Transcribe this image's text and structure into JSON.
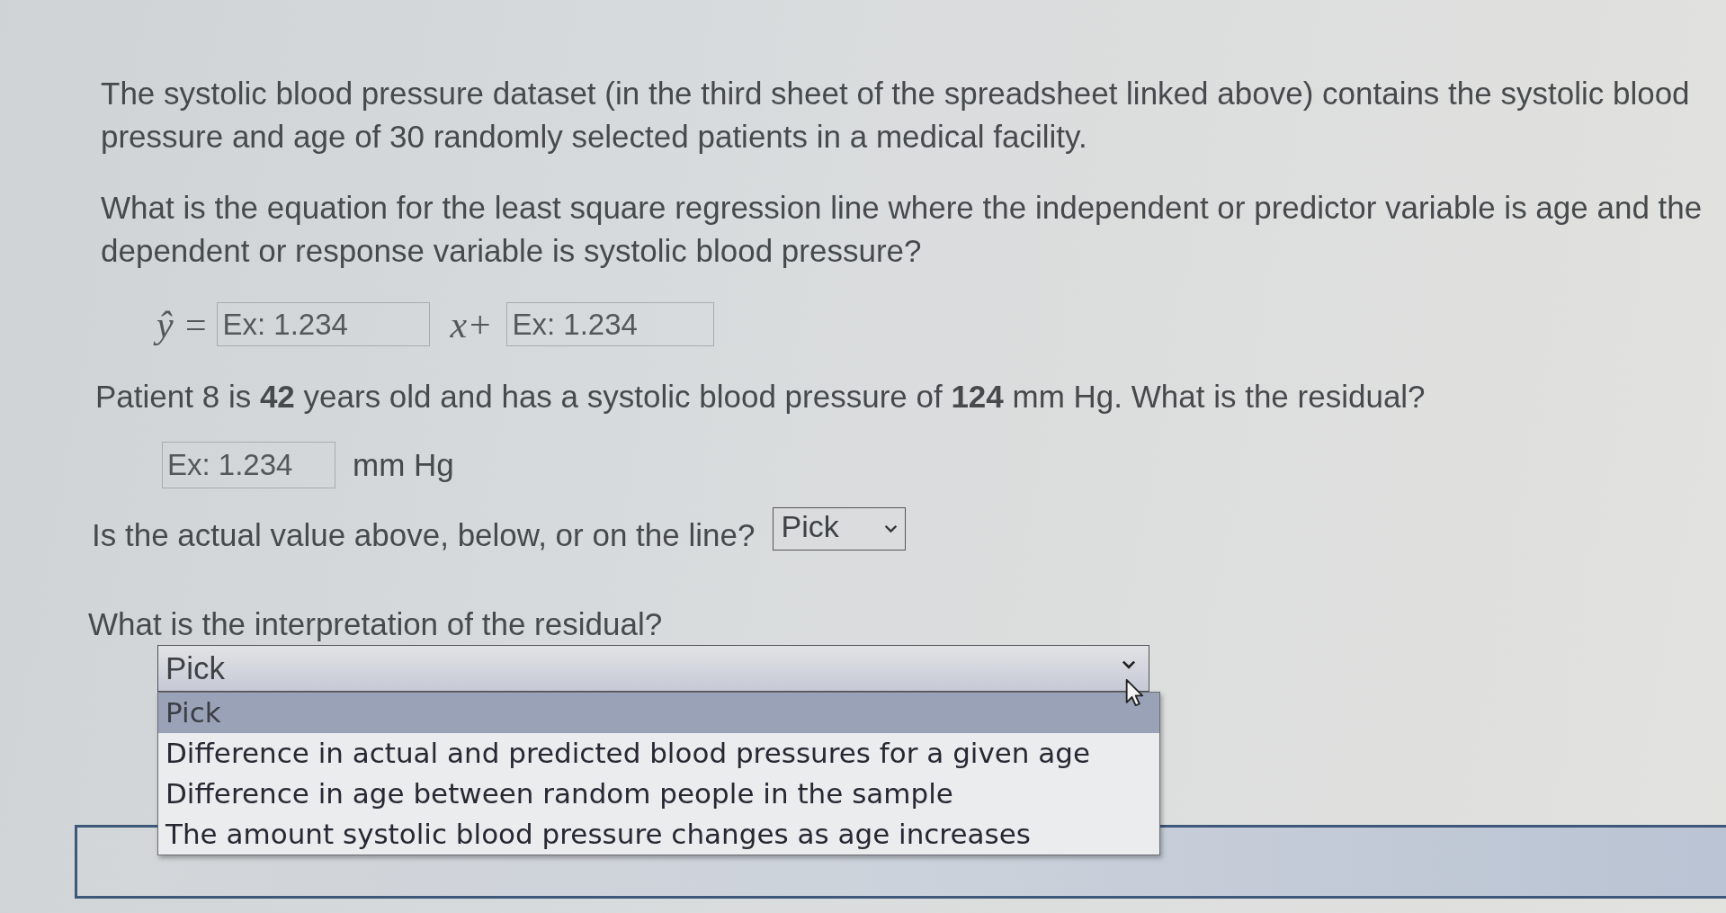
{
  "paragraphs": [
    "The systolic blood pressure dataset (in the third sheet of the spreadsheet linked above) contains the systolic blood pressure and age of 30 randomly selected patients in a medical facility.",
    "What is the equation for the least square regression line where the independent or predictor variable is age and the dependent or response variable is systolic blood pressure?"
  ],
  "equation": {
    "lhs": "ŷ =",
    "slope_field": {
      "placeholder": "Ex: 1.234"
    },
    "operator": "x+",
    "intercept_field": {
      "placeholder": "Ex: 1.234"
    }
  },
  "residual_question": "Patient 8 is **42** years old and has a systolic blood pressure of **124** mm Hg. What is the residual?",
  "residual_field": {
    "placeholder": "Ex: 1.234",
    "unit": "mm Hg"
  },
  "position_question": {
    "label": "Is the actual value above, below, or on the line?",
    "select": {
      "value": "Pick"
    }
  },
  "interpretation_question": {
    "label": "What is the interpretation of the residual?",
    "select": {
      "value": "Pick",
      "open": true,
      "options": [
        {
          "label": "Pick",
          "selected": true
        },
        {
          "label": "Difference in actual and predicted blood pressures for a given age",
          "selected": false
        },
        {
          "label": "Difference in age between random people in the sample",
          "selected": false
        },
        {
          "label": "The amount systolic blood pressure changes as age increases",
          "selected": false
        }
      ]
    }
  }
}
